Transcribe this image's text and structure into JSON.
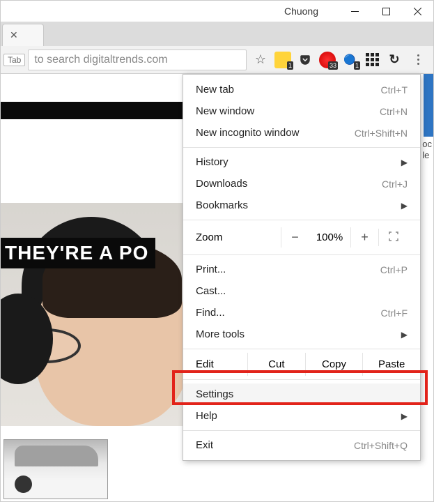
{
  "window": {
    "profile_name": "Chuong"
  },
  "omnibox": {
    "tab_hint": "Tab",
    "text": "to search digitaltrends.com"
  },
  "extensions": {
    "yellow_badge": "1",
    "opera_badge": "33",
    "firefox_badge": "1"
  },
  "page": {
    "headline": "THEY'RE A PO",
    "side_oc": "oc",
    "side_le": "le"
  },
  "menu": {
    "new_tab": "New tab",
    "new_tab_sc": "Ctrl+T",
    "new_window": "New window",
    "new_window_sc": "Ctrl+N",
    "incognito": "New incognito window",
    "incognito_sc": "Ctrl+Shift+N",
    "history": "History",
    "downloads": "Downloads",
    "downloads_sc": "Ctrl+J",
    "bookmarks": "Bookmarks",
    "zoom": "Zoom",
    "zoom_val": "100%",
    "print": "Print...",
    "print_sc": "Ctrl+P",
    "cast": "Cast...",
    "find": "Find...",
    "find_sc": "Ctrl+F",
    "more_tools": "More tools",
    "edit": "Edit",
    "cut": "Cut",
    "copy": "Copy",
    "paste": "Paste",
    "settings": "Settings",
    "help": "Help",
    "exit": "Exit",
    "exit_sc": "Ctrl+Shift+Q"
  }
}
